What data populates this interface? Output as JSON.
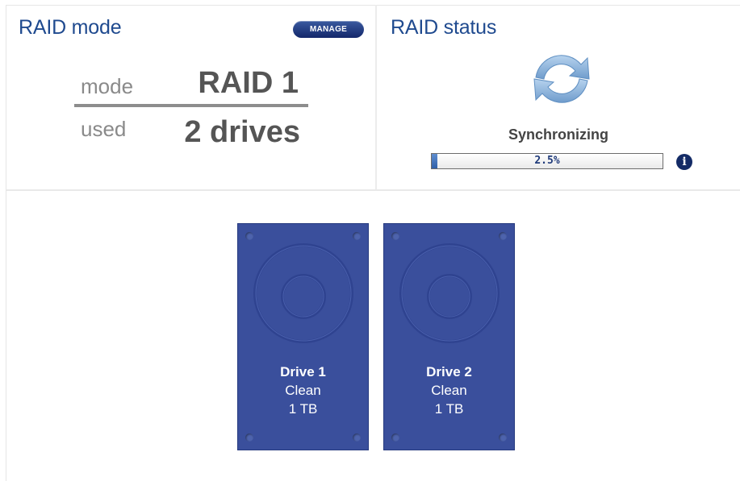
{
  "raid_mode": {
    "title": "RAID mode",
    "manage_label": "MANAGE",
    "mode_label": "mode",
    "mode_value": "RAID 1",
    "used_label": "used",
    "used_value": "2 drives"
  },
  "raid_status": {
    "title": "RAID status",
    "icon": "sync-arrows-icon",
    "status_text": "Synchronizing",
    "progress_text": "2.5%",
    "progress_fraction": 0.025,
    "info_icon": "i"
  },
  "drives": [
    {
      "name": "Drive 1",
      "state": "Clean",
      "size": "1 TB"
    },
    {
      "name": "Drive 2",
      "state": "Clean",
      "size": "1 TB"
    }
  ],
  "colors": {
    "title_blue": "#1f4a8f",
    "drive_fill": "#3a4f9c",
    "button_dark": "#13276a",
    "sync_icon": "#8fb6dc"
  }
}
